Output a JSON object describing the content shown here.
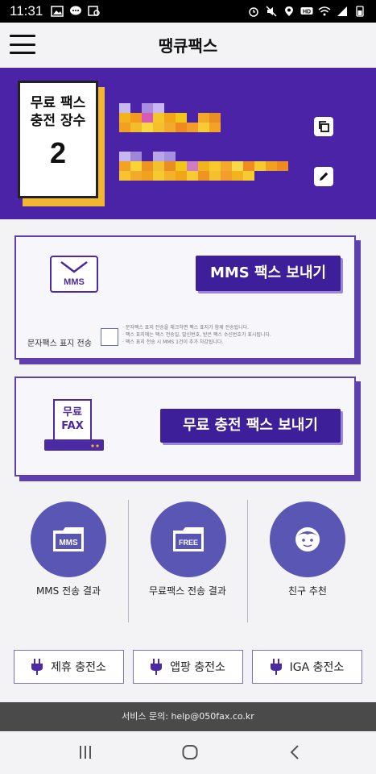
{
  "status_bar": {
    "time": "11:31",
    "icons_left": [
      "image-icon",
      "chat-icon",
      "gallery-search-icon"
    ],
    "icons_right": [
      "alarm-icon",
      "mute-icon",
      "location-icon",
      "hd-icon",
      "wifi-icon",
      "signal-icon",
      "battery-icon"
    ]
  },
  "app_bar": {
    "title": "땡큐팩스",
    "menu_icon": "hamburger-icon"
  },
  "banner": {
    "card_label_line1": "무료 팩스",
    "card_label_line2": "충전 장수",
    "card_count": "2",
    "copy_icon": "copy-icon",
    "edit_icon": "edit-icon"
  },
  "mms_card": {
    "icon_label": "MMS",
    "send_button": "MMS 팩스 보내기",
    "checkbox_label": "문자팩스 표지 전송",
    "notes": [
      "· 문자팩스 표지 전송을 체크하면 팩스 표지가 함께 전송됩니다.",
      "· 팩스 표지에는 팩스 전송일, 발신번호, 받은 팩스 수신번호가 표시됩니다.",
      "· 팩스 표지 전송 시 MMS 1건이 추가 차감됩니다."
    ]
  },
  "free_card": {
    "icon_line1": "무료",
    "icon_line2": "FAX",
    "send_button": "무료 충전 팩스 보내기"
  },
  "results": [
    {
      "label": "MMS 전송 결과",
      "icon": "mms-folder-icon",
      "icon_text": "MMS"
    },
    {
      "label": "무료팩스 전송 결과",
      "icon": "free-folder-icon",
      "icon_text": "FREE"
    },
    {
      "label": "친구 추천",
      "icon": "friend-face-icon",
      "icon_text": ""
    }
  ],
  "stations": [
    {
      "label": "제휴 충전소",
      "icon": "plug-icon"
    },
    {
      "label": "앱팡 충전소",
      "icon": "plug-icon"
    },
    {
      "label": "IGA 충전소",
      "icon": "plug-icon"
    }
  ],
  "footer": {
    "text": "서비스 문의: help@050fax.co.kr"
  },
  "nav_bar": {
    "icons": [
      "recents-icon",
      "home-icon",
      "back-icon"
    ]
  },
  "colors": {
    "brand_purple": "#4b23a7",
    "button_purple": "#3d1f99",
    "circle_purple": "#5a56b4",
    "card_accent": "#f2b632"
  }
}
